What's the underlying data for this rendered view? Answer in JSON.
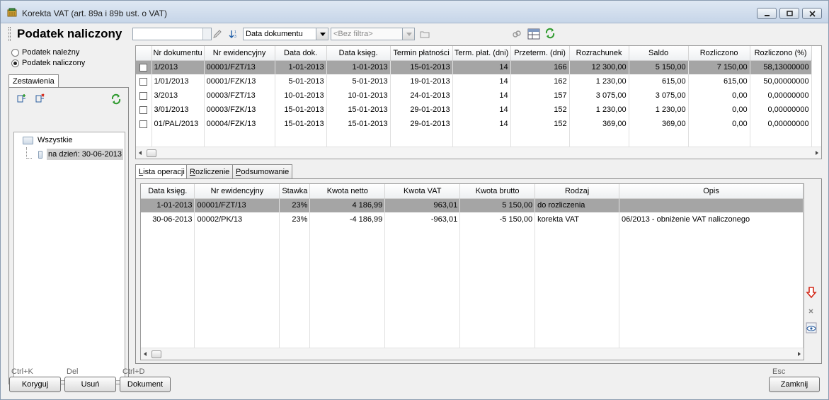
{
  "window": {
    "title": "Korekta VAT (art. 89a i 89b ust. o VAT)"
  },
  "toolbar": {
    "page_title": "Podatek naliczony",
    "search_value": "",
    "sort_combo": "Data dokumentu",
    "filter_combo": "<Bez filtra>"
  },
  "left": {
    "radio_nalezny": "Podatek należny",
    "radio_naliczony": "Podatek naliczony",
    "tab_label": "Zestawienia",
    "tree_root": "Wszystkie",
    "tree_child": "na dzień: 30-06-2013"
  },
  "documents": {
    "columns": [
      "Nr dokumentu",
      "Nr ewidencyjny",
      "Data dok.",
      "Data księg.",
      "Termin płatności",
      "Term. płat. (dni)",
      "Przeterm. (dni)",
      "Rozrachunek",
      "Saldo",
      "Rozliczono",
      "Rozliczono (%)"
    ],
    "rows": [
      [
        "1/2013",
        "00001/FZT/13",
        "1-01-2013",
        "1-01-2013",
        "15-01-2013",
        "14",
        "166",
        "12 300,00",
        "5 150,00",
        "7 150,00",
        "58,13000000"
      ],
      [
        "1/01/2013",
        "00001/FZK/13",
        "5-01-2013",
        "5-01-2013",
        "19-01-2013",
        "14",
        "162",
        "1 230,00",
        "615,00",
        "615,00",
        "50,00000000"
      ],
      [
        "3/2013",
        "00003/FZT/13",
        "10-01-2013",
        "10-01-2013",
        "24-01-2013",
        "14",
        "157",
        "3 075,00",
        "3 075,00",
        "0,00",
        "0,00000000"
      ],
      [
        "3/01/2013",
        "00003/FZK/13",
        "15-01-2013",
        "15-01-2013",
        "29-01-2013",
        "14",
        "152",
        "1 230,00",
        "1 230,00",
        "0,00",
        "0,00000000"
      ],
      [
        "01/PAL/2013",
        "00004/FZK/13",
        "15-01-2013",
        "15-01-2013",
        "29-01-2013",
        "14",
        "152",
        "369,00",
        "369,00",
        "0,00",
        "0,00000000"
      ]
    ]
  },
  "tabs": {
    "lista_pre": "L",
    "lista_rest": "ista operacji",
    "rozl_pre": "R",
    "rozl_rest": "ozliczenie",
    "podsum_pre": "P",
    "podsum_rest": "odsumowanie"
  },
  "operations": {
    "columns": [
      "Data księg.",
      "Nr ewidencyjny",
      "Stawka",
      "Kwota netto",
      "Kwota VAT",
      "Kwota brutto",
      "Rodzaj",
      "Opis"
    ],
    "rows": [
      [
        "1-01-2013",
        "00001/FZT/13",
        "23%",
        "4 186,99",
        "963,01",
        "5 150,00",
        "do rozliczenia",
        ""
      ],
      [
        "30-06-2013",
        "00002/PK/13",
        "23%",
        "-4 186,99",
        "-963,01",
        "-5 150,00",
        "korekta VAT",
        "06/2013 - obniżenie VAT naliczonego"
      ]
    ]
  },
  "buttons": {
    "koryguj": "Koryguj",
    "koryguj_key": "Ctrl+K",
    "usun": "Usuń",
    "usun_key": "Del",
    "dokument": "Dokument",
    "dokument_key": "Ctrl+D",
    "zamknij": "Zamknij",
    "zamknij_key": "Esc"
  },
  "colors": {
    "selected_row": "#a5a5a5",
    "refresh_green": "#2e9a2e",
    "arrow_red": "#d42a1a"
  }
}
